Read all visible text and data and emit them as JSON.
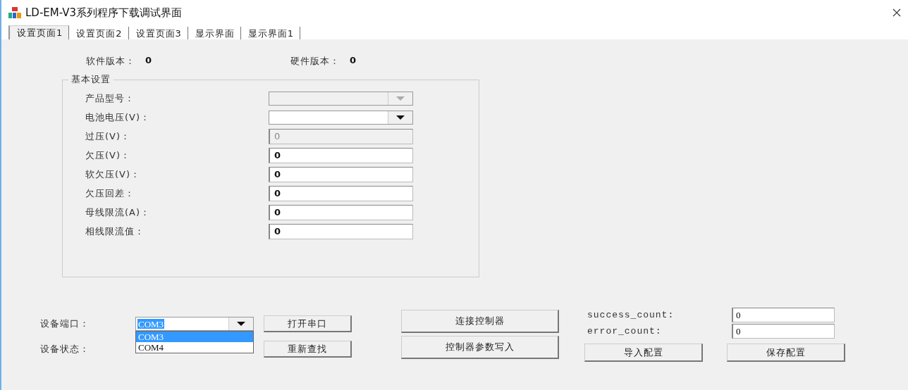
{
  "window": {
    "title": "LD-EM-V3系列程序下载调试界面"
  },
  "tabs": [
    {
      "label": "设置页面1",
      "selected": true
    },
    {
      "label": "设置页面2",
      "selected": false
    },
    {
      "label": "设置页面3",
      "selected": false
    },
    {
      "label": "显示界面",
      "selected": false
    },
    {
      "label": "显示界面1",
      "selected": false
    }
  ],
  "versions": [
    {
      "label": "软件版本：",
      "value": "0"
    },
    {
      "label": "硬件版本：",
      "value": "0"
    }
  ],
  "basic_settings": {
    "title": "基本设置",
    "fields": [
      {
        "label": "产品型号：",
        "kind": "combo",
        "disabled": true
      },
      {
        "label": "电池电压(V)：",
        "kind": "combo",
        "disabled": false
      },
      {
        "label": "过压(V)：",
        "kind": "text",
        "value": "0",
        "disabled": true
      },
      {
        "label": "欠压(V)：",
        "kind": "text",
        "value": "0",
        "disabled": false
      },
      {
        "label": "软欠压(V)：",
        "kind": "text",
        "value": "0",
        "disabled": false
      },
      {
        "label": "欠压回差：",
        "kind": "text",
        "value": "0",
        "disabled": false
      },
      {
        "label": "母线限流(A)：",
        "kind": "text",
        "value": "0",
        "disabled": false
      },
      {
        "label": "相线限流值：",
        "kind": "text",
        "value": "0",
        "disabled": false
      }
    ]
  },
  "device_port": {
    "label": "设备端口：",
    "value": "COM3",
    "expanded": true,
    "options": [
      {
        "label": "COM3",
        "selected": true
      },
      {
        "label": "COM4",
        "selected": false
      }
    ]
  },
  "device_status": {
    "label": "设备状态："
  },
  "serial_buttons": [
    "打开串口",
    "重新查找"
  ],
  "controller_buttons": [
    "连接控制器",
    "控制器参数写入"
  ],
  "counters": [
    {
      "label": "success_count:",
      "value": "0"
    },
    {
      "label": "error_count:",
      "value": "0"
    }
  ],
  "config_buttons": [
    "导入配置",
    "保存配置"
  ]
}
